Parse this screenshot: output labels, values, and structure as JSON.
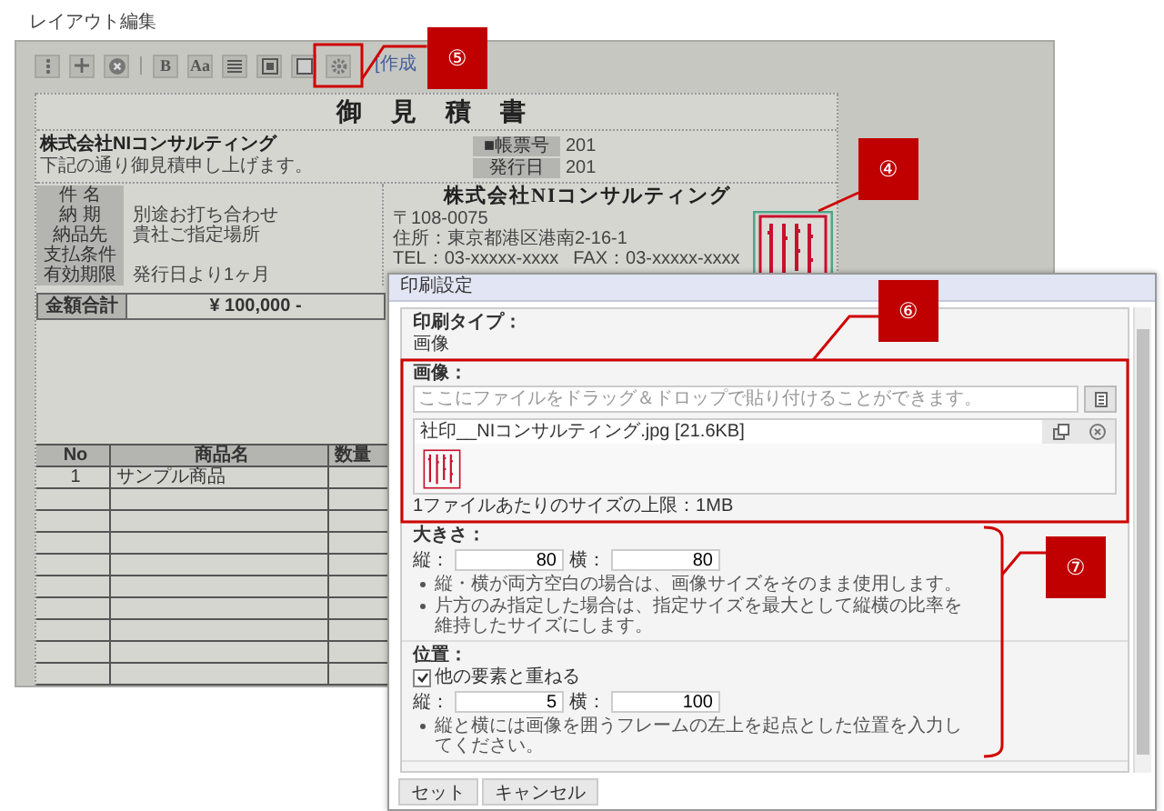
{
  "window": {
    "title": "レイアウト編集"
  },
  "toolbar": {
    "items": [
      {
        "kind": "menu"
      },
      {
        "kind": "add"
      },
      {
        "kind": "remove"
      },
      {
        "kind": "separator"
      },
      {
        "kind": "text",
        "label": "B"
      },
      {
        "kind": "text",
        "label": "Aa"
      },
      {
        "kind": "align"
      },
      {
        "kind": "frame"
      },
      {
        "kind": "border"
      },
      {
        "kind": "settings"
      }
    ],
    "link": "[作成"
  },
  "document": {
    "title": "御 見 積 書",
    "customer": "株式会社NIコンサルティング",
    "greeting": "下記の通り御見積申し上げます。",
    "meta": [
      {
        "label": "■帳票号",
        "value": "201"
      },
      {
        "label": "発行日",
        "value": "201"
      }
    ],
    "details": [
      {
        "label": "件 名"
      },
      {
        "label": "納 期",
        "value": "別途お打ち合わせ"
      },
      {
        "label": "納品先",
        "value": "貴社ご指定場所"
      },
      {
        "label": "支払条件"
      },
      {
        "label": "有効期限",
        "value": "発行日より1ヶ月"
      }
    ],
    "issuer": {
      "name": "株式会社NIコンサルティング",
      "postal": "〒108-0075",
      "address": "住所：東京都港区港南2-16-1",
      "tel": "TEL：03-xxxxx-xxxx",
      "fax": "FAX：03-xxxxx-xxxx"
    },
    "total": {
      "label": "金額合計",
      "value": "¥ 100,000 -"
    },
    "items": {
      "columns": [
        "No",
        "商品名",
        "数量"
      ],
      "rows": [
        [
          "1",
          "サンプル商品"
        ]
      ]
    }
  },
  "dialog": {
    "title": "印刷設定",
    "print_type": {
      "label": "印刷タイプ：",
      "value": "画像"
    },
    "image": {
      "label": "画像：",
      "placeholder": "ここにファイルをドラッグ＆ドロップで貼り付けることができます。",
      "file": "社印__NIコンサルティング.jpg [21.6KB]",
      "limit": "1ファイルあたりのサイズの上限：1MB"
    },
    "size": {
      "label": "大きさ：",
      "fields": [
        {
          "label": "縦：",
          "value": "80"
        },
        {
          "label": "横：",
          "value": "80"
        }
      ],
      "notes": [
        "縦・横が両方空白の場合は、画像サイズをそのまま使用します。",
        "片方のみ指定した場合は、指定サイズを最大として縦横の比率を維持したサイズにします。"
      ]
    },
    "position": {
      "label": "位置：",
      "overlap": {
        "label": "他の要素と重ねる",
        "checked": true
      },
      "fields": [
        {
          "label": "縦：",
          "value": "5"
        },
        {
          "label": "横：",
          "value": "100"
        }
      ],
      "notes": [
        "縦と横には画像を囲うフレームの左上を起点とした位置を入力してください。"
      ]
    },
    "buttons": [
      "セット",
      "キャンセル"
    ]
  },
  "annotations": [
    {
      "number": "⑤",
      "kind": "box"
    },
    {
      "number": "④",
      "kind": "line"
    },
    {
      "number": "⑥",
      "kind": "box"
    },
    {
      "number": "⑦",
      "kind": "brace"
    }
  ]
}
